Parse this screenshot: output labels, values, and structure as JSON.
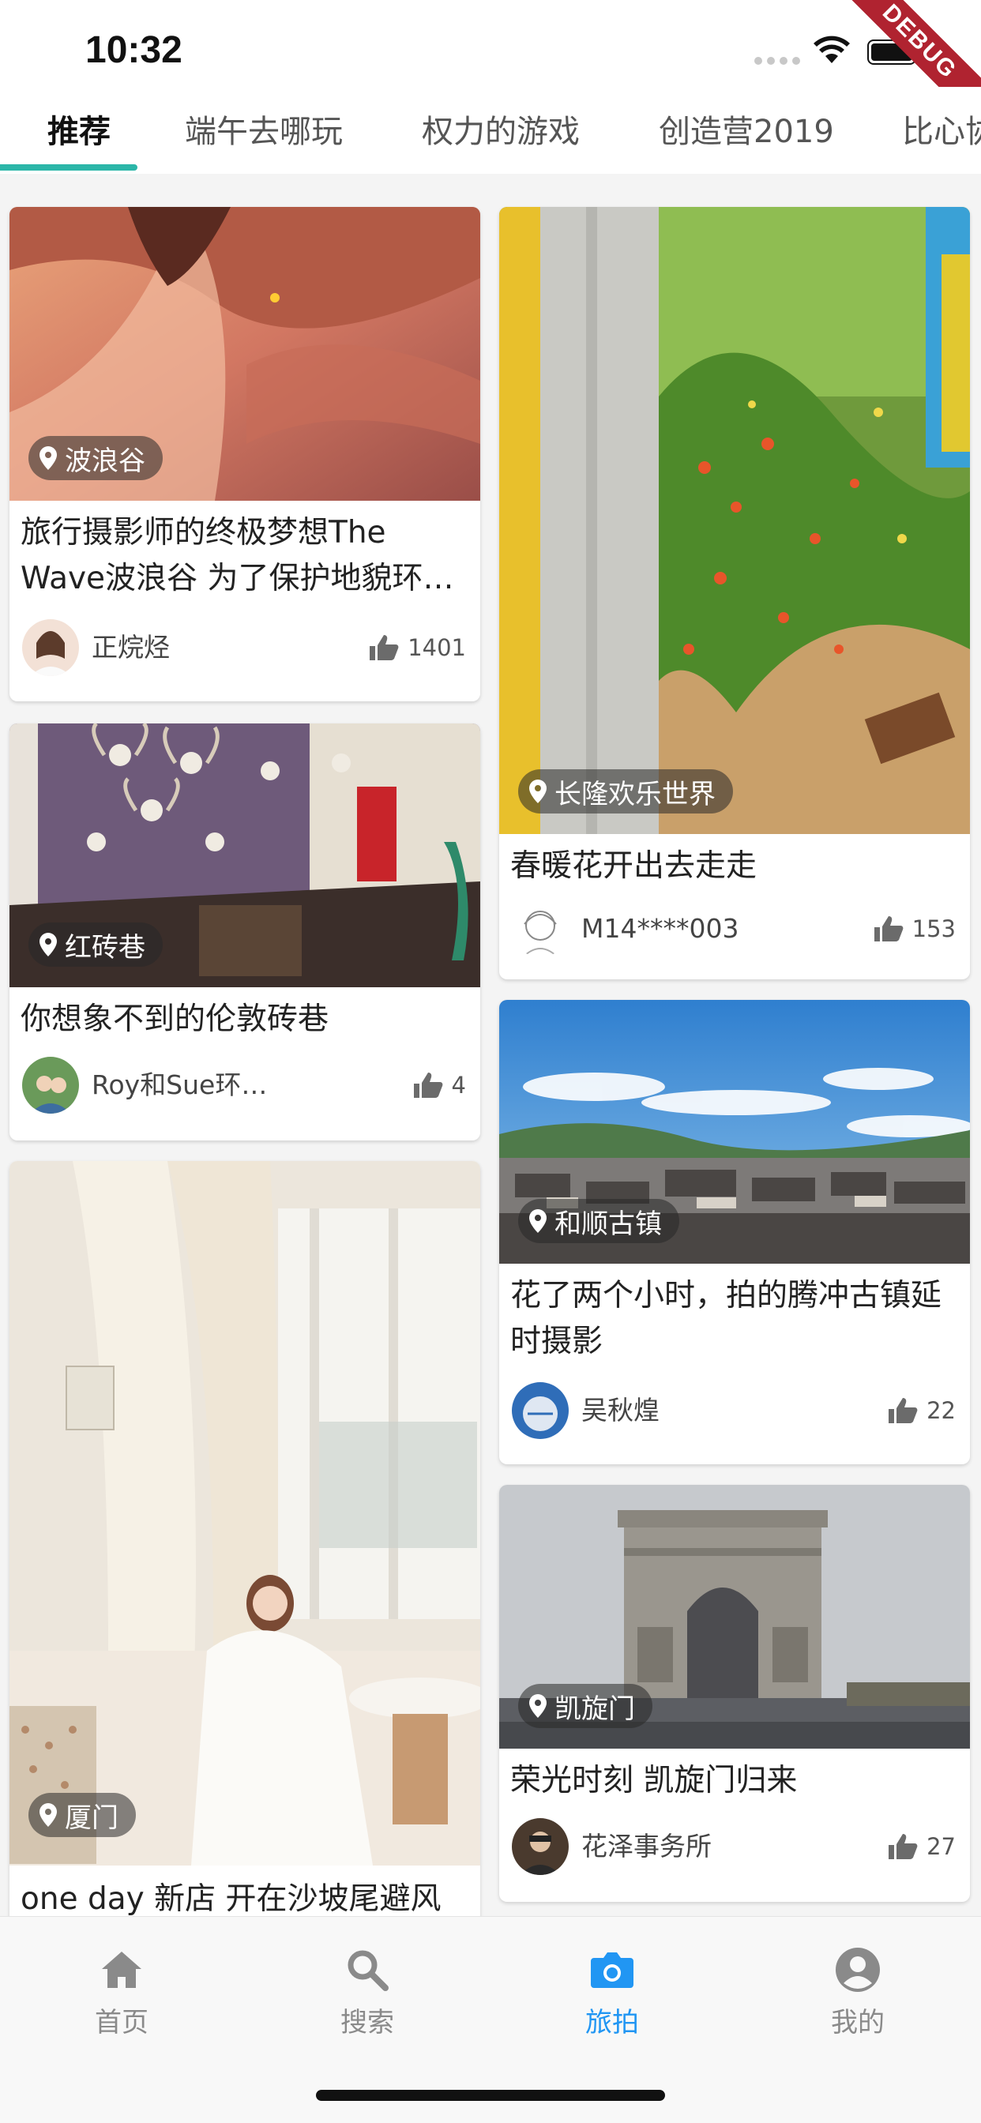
{
  "status_bar": {
    "time": "10:32",
    "debug_label": "DEBUG"
  },
  "tabs": [
    {
      "label": "推荐",
      "active": true
    },
    {
      "label": "端午去哪玩",
      "active": false
    },
    {
      "label": "权力的游戏",
      "active": false
    },
    {
      "label": "创造营2019",
      "active": false
    },
    {
      "label": "比心协",
      "active": false
    }
  ],
  "cards": [
    {
      "location": "波浪谷",
      "title": "旅行摄影师的终极梦想The Wave波浪谷 为了保护地貌环…",
      "author": "正烷烃",
      "likes": "1401"
    },
    {
      "location": "长隆欢乐世界",
      "title": "春暖花开出去走走",
      "author": "M14****003",
      "likes": "153"
    },
    {
      "location": "红砖巷",
      "title": "你想象不到的伦敦砖巷",
      "author": "Roy和Sue环…",
      "likes": "4"
    },
    {
      "location": "和顺古镇",
      "title": "花了两个小时，拍的腾冲古镇延时摄影",
      "author": "吴秋煌",
      "likes": "22"
    },
    {
      "location": "厦门",
      "title": "one day 新店 开在沙坡尾避风",
      "author": "",
      "likes": ""
    },
    {
      "location": "凯旋门",
      "title": "荣光时刻 凯旋门归来",
      "author": "花泽事务所",
      "likes": "27"
    }
  ],
  "bottom_nav": [
    {
      "label": "首页",
      "icon": "home-icon",
      "active": false
    },
    {
      "label": "搜索",
      "icon": "search-icon",
      "active": false
    },
    {
      "label": "旅拍",
      "icon": "camera-icon",
      "active": true
    },
    {
      "label": "我的",
      "icon": "account-icon",
      "active": false
    }
  ],
  "colors": {
    "tab_indicator": "#2bb6a8",
    "nav_active": "#2196f3",
    "nav_inactive": "#8a8a8a"
  }
}
